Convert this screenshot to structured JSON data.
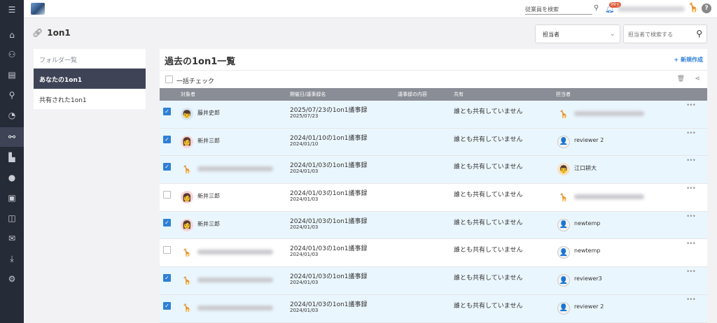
{
  "sidebar": {
    "icons": [
      "menu-icon",
      "home-icon",
      "org-chart-icon",
      "document-icon",
      "search-icon",
      "chat-icon",
      "link-icon",
      "chart-icon",
      "info-icon",
      "contacts-icon",
      "book-icon",
      "mail-icon",
      "download-icon",
      "user-settings-icon"
    ],
    "active_index": 6
  },
  "topbar": {
    "employee_search_placeholder": "従業員を検索",
    "notification_count": "99+",
    "help_label": "?"
  },
  "page": {
    "title": "1on1",
    "assignee_select_value": "担当者",
    "assignee_search_placeholder": "担当者で検索する"
  },
  "folders": {
    "heading": "フォルダ一覧",
    "items": [
      {
        "label": "あなたの1on1",
        "active": true
      },
      {
        "label": "共有された1on1",
        "active": false
      }
    ]
  },
  "main": {
    "title": "過去の1on1一覧",
    "new_button": "+ 新規作成",
    "bulk_check_label": "一括チェック",
    "columns": {
      "subject": "対象者",
      "date": "開催日/議事録名",
      "content": "議事録の内容",
      "shared": "共有",
      "assignee": "担当者"
    },
    "rows": [
      {
        "checked": true,
        "subject_avatar": "male",
        "subject": "藤井史郎",
        "title": "2025/07/23の1on1議事録",
        "date": "2025/07/23",
        "shared": "誰とも共有していません",
        "assignee_avatar": "giraffe",
        "assignee": ""
      },
      {
        "checked": true,
        "subject_avatar": "female",
        "subject": "新井三郎",
        "title": "2024/01/10の1on1議事録",
        "date": "2024/01/10",
        "shared": "誰とも共有していません",
        "assignee_avatar": "person",
        "assignee": "reviewer 2"
      },
      {
        "checked": true,
        "subject_avatar": "giraffe",
        "subject": "",
        "title": "2024/01/03の1on1議事録",
        "date": "2024/01/03",
        "shared": "誰とも共有していません",
        "assignee_avatar": "man",
        "assignee": "江口耕大"
      },
      {
        "checked": false,
        "subject_avatar": "female",
        "subject": "新井三郎",
        "title": "2024/01/03の1on1議事録",
        "date": "2024/01/03",
        "shared": "誰とも共有していません",
        "assignee_avatar": "giraffe",
        "assignee": ""
      },
      {
        "checked": true,
        "subject_avatar": "female",
        "subject": "新井三郎",
        "title": "2024/01/03の1on1議事録",
        "date": "2024/01/03",
        "shared": "誰とも共有していません",
        "assignee_avatar": "person",
        "assignee": "newtemp"
      },
      {
        "checked": false,
        "subject_avatar": "giraffe",
        "subject": "",
        "title": "2024/01/03の1on1議事録",
        "date": "2024/01/03",
        "shared": "誰とも共有していません",
        "assignee_avatar": "person",
        "assignee": "newtemp"
      },
      {
        "checked": true,
        "subject_avatar": "giraffe",
        "subject": "",
        "title": "2024/01/03の1on1議事録",
        "date": "2024/01/03",
        "shared": "誰とも共有していません",
        "assignee_avatar": "person",
        "assignee": "reviewer3"
      },
      {
        "checked": true,
        "subject_avatar": "giraffe",
        "subject": "",
        "title": "2024/01/03の1on1議事録",
        "date": "2024/01/03",
        "shared": "誰とも共有していません",
        "assignee_avatar": "person",
        "assignee": "reviewer 2"
      }
    ]
  },
  "colors": {
    "sidebar_bg": "#262b38",
    "accent": "#2f7fd6",
    "header_row": "#8a8d96",
    "selected_row": "#eaf6fd"
  }
}
